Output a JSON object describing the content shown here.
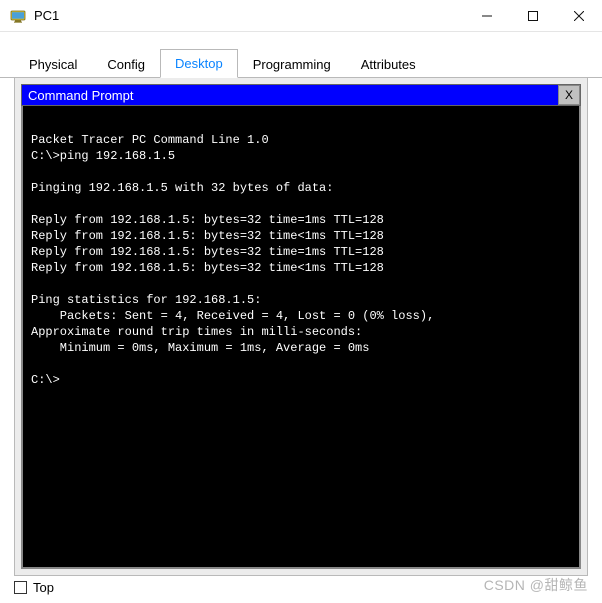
{
  "window": {
    "title": "PC1"
  },
  "tabs": {
    "t0": "Physical",
    "t1": "Config",
    "t2": "Desktop",
    "t3": "Programming",
    "t4": "Attributes",
    "active_index": 2
  },
  "command_prompt": {
    "title": "Command Prompt",
    "close_label": "X",
    "lines": {
      "l0": "",
      "l1": "Packet Tracer PC Command Line 1.0",
      "l2": "C:\\>ping 192.168.1.5",
      "l3": "",
      "l4": "Pinging 192.168.1.5 with 32 bytes of data:",
      "l5": "",
      "l6": "Reply from 192.168.1.5: bytes=32 time=1ms TTL=128",
      "l7": "Reply from 192.168.1.5: bytes=32 time<1ms TTL=128",
      "l8": "Reply from 192.168.1.5: bytes=32 time=1ms TTL=128",
      "l9": "Reply from 192.168.1.5: bytes=32 time<1ms TTL=128",
      "l10": "",
      "l11": "Ping statistics for 192.168.1.5:",
      "l12": "    Packets: Sent = 4, Received = 4, Lost = 0 (0% loss),",
      "l13": "Approximate round trip times in milli-seconds:",
      "l14": "    Minimum = 0ms, Maximum = 1ms, Average = 0ms",
      "l15": "",
      "l16": "C:\\>"
    }
  },
  "footer": {
    "top_label": "Top",
    "top_checked": false
  },
  "watermark": "CSDN @甜鲸鱼"
}
